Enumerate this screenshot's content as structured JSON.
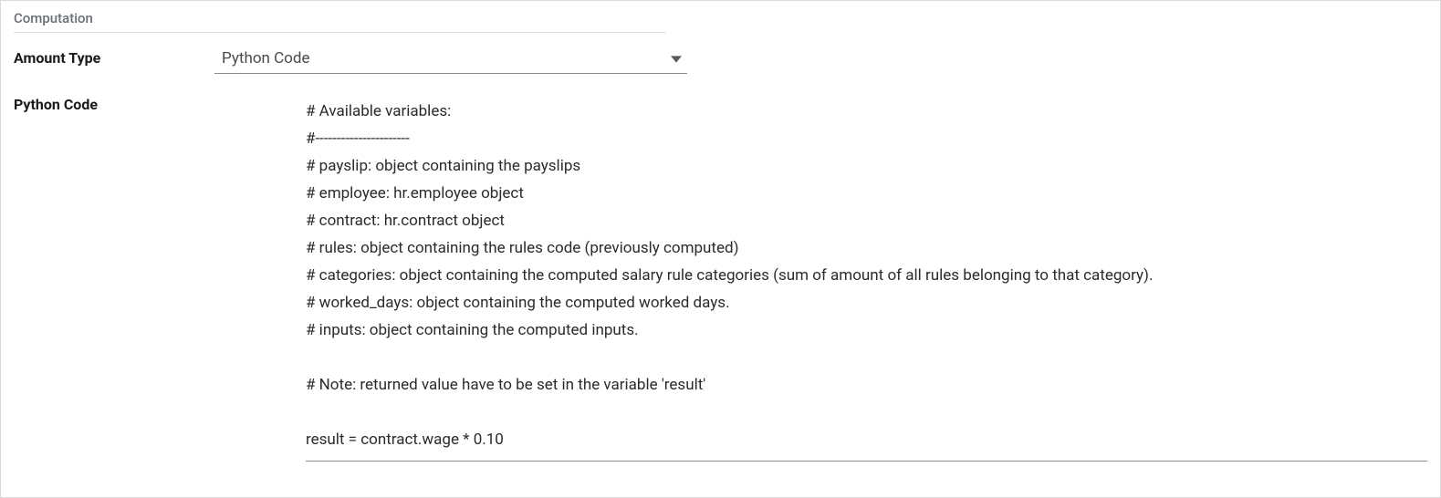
{
  "section": {
    "title": "Computation"
  },
  "fields": {
    "amount_type": {
      "label": "Amount Type",
      "value": "Python Code"
    },
    "python_code": {
      "label": "Python Code",
      "value": "# Available variables:\n#----------------------\n# payslip: object containing the payslips\n# employee: hr.employee object\n# contract: hr.contract object\n# rules: object containing the rules code (previously computed)\n# categories: object containing the computed salary rule categories (sum of amount of all rules belonging to that category).\n# worked_days: object containing the computed worked days.\n# inputs: object containing the computed inputs.\n\n# Note: returned value have to be set in the variable 'result'\n\nresult = contract.wage * 0.10"
    }
  }
}
